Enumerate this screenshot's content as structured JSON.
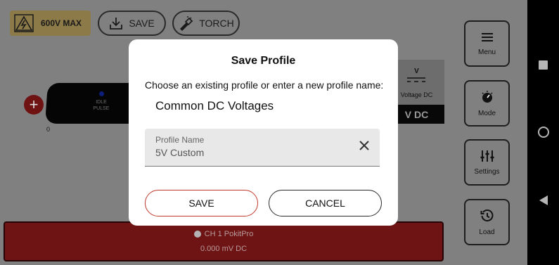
{
  "toolbar": {
    "max_voltage": "600V MAX",
    "save_label": "SAVE",
    "torch_label": "TORCH"
  },
  "side_menu": {
    "menu": "Menu",
    "mode": "Mode",
    "settings": "Settings",
    "load": "Load"
  },
  "meter": {
    "scope_status_line1": "IDLE",
    "scope_status_line2": "PULSE",
    "axis_zero": "0",
    "unit_symbol": "V",
    "unit_caption": "Voltage DC",
    "unit_short": "V DC"
  },
  "channel": {
    "name": "CH 1 PokitPro",
    "reading": "0.000 mV DC"
  },
  "dialog": {
    "title": "Save Profile",
    "message": "Choose an existing profile or enter a new profile name:",
    "existing_profile": "Common DC Voltages",
    "input_label": "Profile Name",
    "input_value": "5V Custom",
    "save_button": "SAVE",
    "cancel_button": "CANCEL"
  },
  "colors": {
    "accent": "#d9534f",
    "save_border": "#c0392b",
    "warning_bg": "#8c7a48",
    "channel_bg": "#6e1414"
  },
  "icons": [
    "warning-icon",
    "download-icon",
    "flashlight-icon",
    "hamburger-icon",
    "dial-icon",
    "sliders-icon",
    "history-icon",
    "clear-icon",
    "square-nav-icon",
    "circle-nav-icon",
    "back-nav-icon"
  ]
}
